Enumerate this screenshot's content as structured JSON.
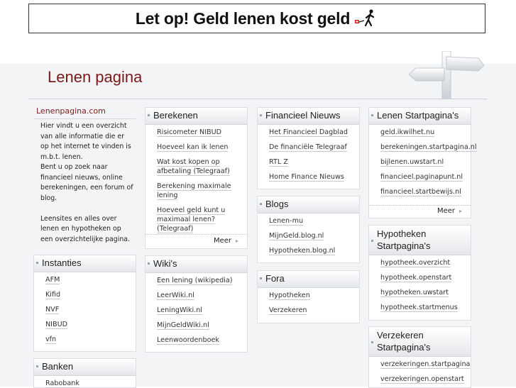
{
  "banner": {
    "text": "Let op! Geld lenen kost geld"
  },
  "site": {
    "title": "Lenen pagina"
  },
  "intro": {
    "title": "Lenenpagina.com",
    "body": "Hier vindt u een overzicht van alle informatie die er op het internet te vinden is m.b.t. lenen.\nBent u op zoek naar financieel nieuws, online berekeningen, een forum of blog.\n\nLeensites en alles over lenen en hypotheken op een overzichtelijke pagina."
  },
  "instanties": {
    "title": "Instanties",
    "items": [
      "AFM",
      "Kifid",
      "NVF",
      "NIBUD",
      "vfn"
    ]
  },
  "banken": {
    "title": "Banken",
    "items": [
      "Rabobank"
    ]
  },
  "berekenen": {
    "title": "Berekenen",
    "items": [
      "Risicometer NIBUD",
      "Hoeveel kan ik lenen",
      "Wat kost kopen op afbetaling (Telegraaf)",
      "Berekening maximale lening",
      "Hoeveel geld kunt u maximaal lenen? (Telegraaf)"
    ],
    "more": "Meer"
  },
  "wikis": {
    "title": "Wiki's",
    "items": [
      "Een lening (wikipedia)",
      "LeerWiki.nl",
      "LeningWiki.nl",
      "MijnGeldWiki.nl",
      "Leenwoordenboek"
    ]
  },
  "nieuws": {
    "title": "Financieel Nieuws",
    "items": [
      "Het Financieel Dagblad",
      "De financiële Telegraaf",
      "RTL Z",
      "Home Finance Nieuws"
    ]
  },
  "blogs": {
    "title": "Blogs",
    "items": [
      "Lenen-mu",
      "MijnGeld.blog.nl",
      "Hypotheken.blog.nl"
    ]
  },
  "fora": {
    "title": "Fora",
    "items": [
      "Hypotheken",
      "Verzekeren"
    ]
  },
  "startpaginas": {
    "title": "Lenen Startpagina's",
    "items": [
      "geld.ikwilhet.nu",
      "berekeningen.startpagina.nl",
      "bijlenen.uwstart.nl",
      "financieel.paginapunt.nl",
      "financieel.startbewijs.nl"
    ],
    "more": "Meer"
  },
  "hypotheken": {
    "title": "Hypotheken Startpagina's",
    "items": [
      "hypotheek.overzicht",
      "hypotheek.openstart",
      "hypotheken.uwstart",
      "hypotheek.startmenus"
    ]
  },
  "verzekeren": {
    "title": "Verzekeren Startpagina's",
    "items": [
      "verzekeringen.startpagina",
      "verzekeringen.openstart"
    ]
  }
}
